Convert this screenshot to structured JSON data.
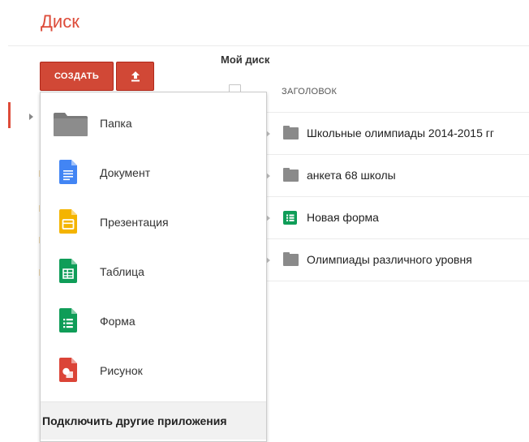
{
  "app": {
    "title": "Диск"
  },
  "toolbar": {
    "create_label": "СОЗДАТЬ",
    "upload_icon": "upload-icon"
  },
  "breadcrumb": {
    "label": "Мой диск"
  },
  "file_list": {
    "header_title": "ЗАГОЛОВОК",
    "rows": [
      {
        "name": "Школьные олимпиады 2014-2015 гг",
        "icon": "folder-icon"
      },
      {
        "name": "анкета 68 школы",
        "icon": "folder-icon"
      },
      {
        "name": "Новая форма",
        "icon": "form-icon"
      },
      {
        "name": "Олимпиады различного уровня",
        "icon": "folder-icon"
      }
    ]
  },
  "create_menu": {
    "items": [
      {
        "label": "Папка",
        "icon": "folder-icon",
        "color": "#7a7a7a"
      },
      {
        "label": "Документ",
        "icon": "docs-icon",
        "color": "#4285f4"
      },
      {
        "label": "Презентация",
        "icon": "slides-icon",
        "color": "#f4b400"
      },
      {
        "label": "Таблица",
        "icon": "sheets-icon",
        "color": "#0f9d58"
      },
      {
        "label": "Форма",
        "icon": "forms-icon",
        "color": "#0f9d58"
      },
      {
        "label": "Рисунок",
        "icon": "drawings-icon",
        "color": "#db4437"
      }
    ],
    "footer_label": "Подключить другие приложения"
  },
  "colors": {
    "accent": "#dd4b39",
    "create_button": "#d14836"
  }
}
